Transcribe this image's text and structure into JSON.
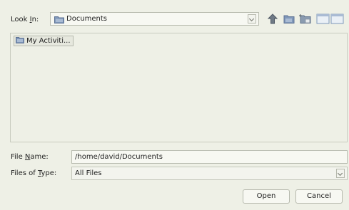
{
  "look_in": {
    "label_pre": "Look ",
    "label_mnemonic": "I",
    "label_post": "n:",
    "value": "Documents"
  },
  "toolbar": {
    "up_icon": "up-folder-icon",
    "home_icon": "home-folder-icon",
    "new_folder_icon": "new-folder-icon",
    "view_icon": "list-details-view-icon"
  },
  "files": [
    {
      "name": "My Activiti...",
      "icon": "folder-icon"
    }
  ],
  "file_name": {
    "label_pre": "File ",
    "label_mnemonic": "N",
    "label_post": "ame:",
    "value": "/home/david/Documents"
  },
  "files_of_type": {
    "label_pre": "Files of ",
    "label_mnemonic": "T",
    "label_post": "ype:",
    "value": "All Files"
  },
  "buttons": {
    "open": "Open",
    "cancel": "Cancel"
  },
  "colors": {
    "background": "#eef0e6",
    "folder_blue": "#7f97b9"
  }
}
